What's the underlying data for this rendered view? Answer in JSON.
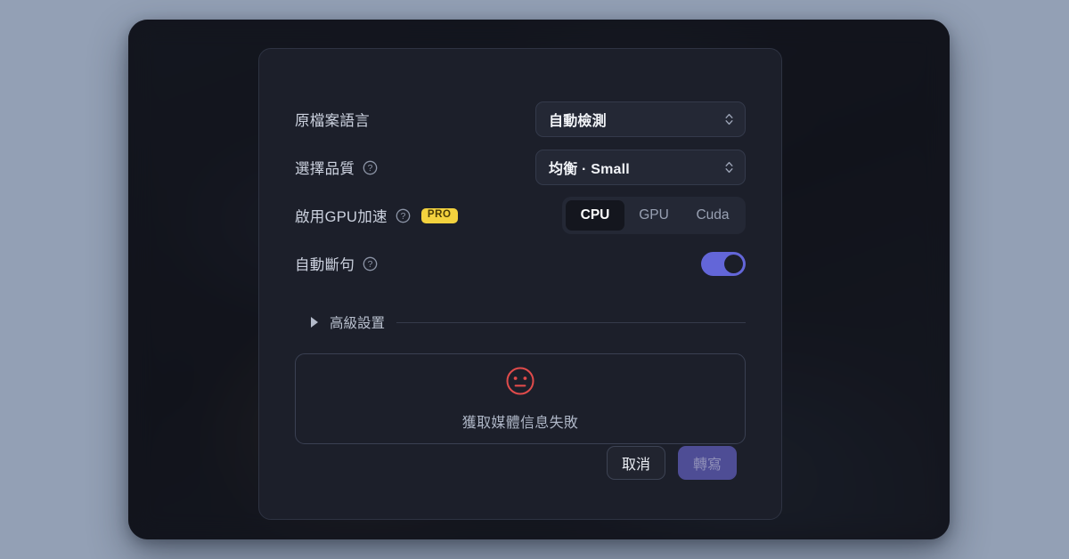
{
  "dialog": {
    "rows": [
      {
        "label": "原檔案語言",
        "has_help": false,
        "has_pro": false,
        "control": "select",
        "value": "自動檢測"
      },
      {
        "label": "選擇品質",
        "has_help": true,
        "has_pro": false,
        "control": "select",
        "value": "均衡 · Small"
      },
      {
        "label": "啟用GPU加速",
        "has_help": true,
        "has_pro": true,
        "pro_badge": "PRO",
        "control": "segmented",
        "value": "CPU"
      },
      {
        "label": "自動斷句",
        "has_help": true,
        "has_pro": false,
        "control": "toggle",
        "value": "on"
      }
    ],
    "segments": [
      "CPU",
      "GPU",
      "Cuda"
    ],
    "advanced": {
      "label": "高級設置",
      "expanded": false
    },
    "error": {
      "icon": "neutral-face-icon",
      "message": "獲取媒體信息失敗"
    },
    "footer": {
      "cancel_label": "取消",
      "transcribe_label": "轉寫",
      "transcribe_disabled": true
    }
  },
  "colors": {
    "page_background": "#93a0b5",
    "window_background": "#1b1d26",
    "dialog_background": "#1c1f2a",
    "accent_purple": "#6366d8",
    "primary_button": "#4e4d95",
    "pro_badge": "#f3d23e",
    "error_red": "#e04b4b"
  }
}
